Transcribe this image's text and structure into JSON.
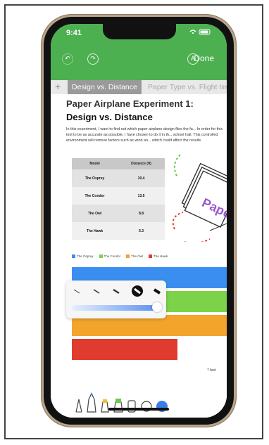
{
  "status": {
    "time": "9:41"
  },
  "toolbar": {
    "done_label": "Done"
  },
  "tabs": {
    "add_label": "+",
    "active_label": "Design vs. Distance",
    "inactive_label": "Paper Type vs. Flight tim"
  },
  "doc": {
    "title": "Paper Airplane Experiment 1:",
    "subtitle": "Design vs. Distance",
    "body": "In this experiment, I want to find out which paper airplane design flies the fa... In order for this test to be as accurate as possible, I have chosen to do it in th... school hall. This controlled environment will remove factors such as wind an... which could affect the results.",
    "table": {
      "headers": [
        "Model",
        "Distance (ft)"
      ],
      "rows": [
        [
          "The Osprey",
          "10.4"
        ],
        [
          "The Condor",
          "13.5"
        ],
        [
          "The Owl",
          "8.8"
        ],
        [
          "The Hawk",
          "5.3"
        ]
      ]
    },
    "legend": [
      {
        "label": "The Osprey",
        "color": "#3a8ef0"
      },
      {
        "label": "The Condor",
        "color": "#7cd34a"
      },
      {
        "label": "The Owl",
        "color": "#f3a42b"
      },
      {
        "label": "The Hawk",
        "color": "#e03b2f"
      }
    ],
    "axis_label": "7 feet",
    "sketch_text": "Pape"
  },
  "colors": {
    "header": "#4caf50",
    "slider": "#5b8ff0",
    "selected_color": "#3a7fe8"
  }
}
